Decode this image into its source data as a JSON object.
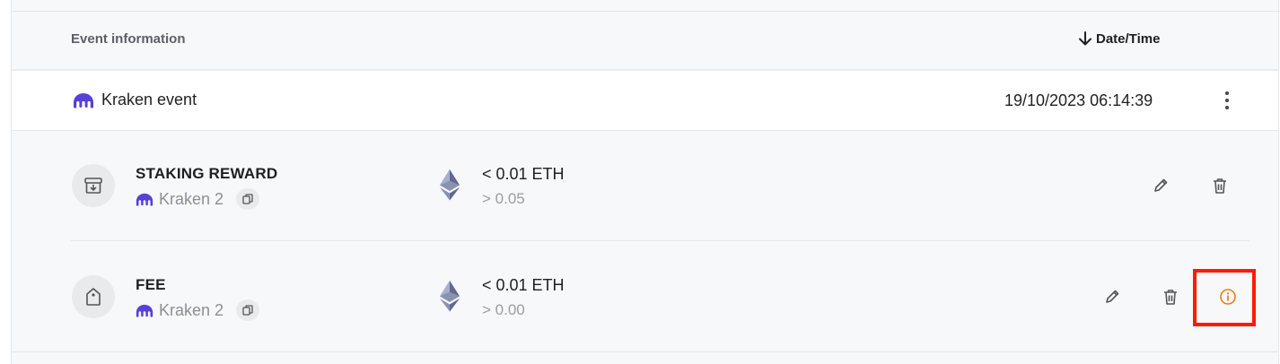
{
  "header": {
    "event_info_label": "Event information",
    "date_time_label": "Date/Time"
  },
  "event": {
    "name": "Kraken event",
    "datetime": "19/10/2023 06:14:39"
  },
  "entries": [
    {
      "type": "STAKING REWARD",
      "location": "Kraken 2",
      "amount": "< 0.01 ETH",
      "value": "> 0.05",
      "icon": "archive-download-icon"
    },
    {
      "type": "FEE",
      "location": "Kraken 2",
      "amount": "< 0.01 ETH",
      "value": "> 0.00",
      "icon": "tag-icon"
    }
  ],
  "colors": {
    "kraken_purple": "#5741d9",
    "info_orange": "#f07a16",
    "highlight_red": "#ff1a05"
  }
}
